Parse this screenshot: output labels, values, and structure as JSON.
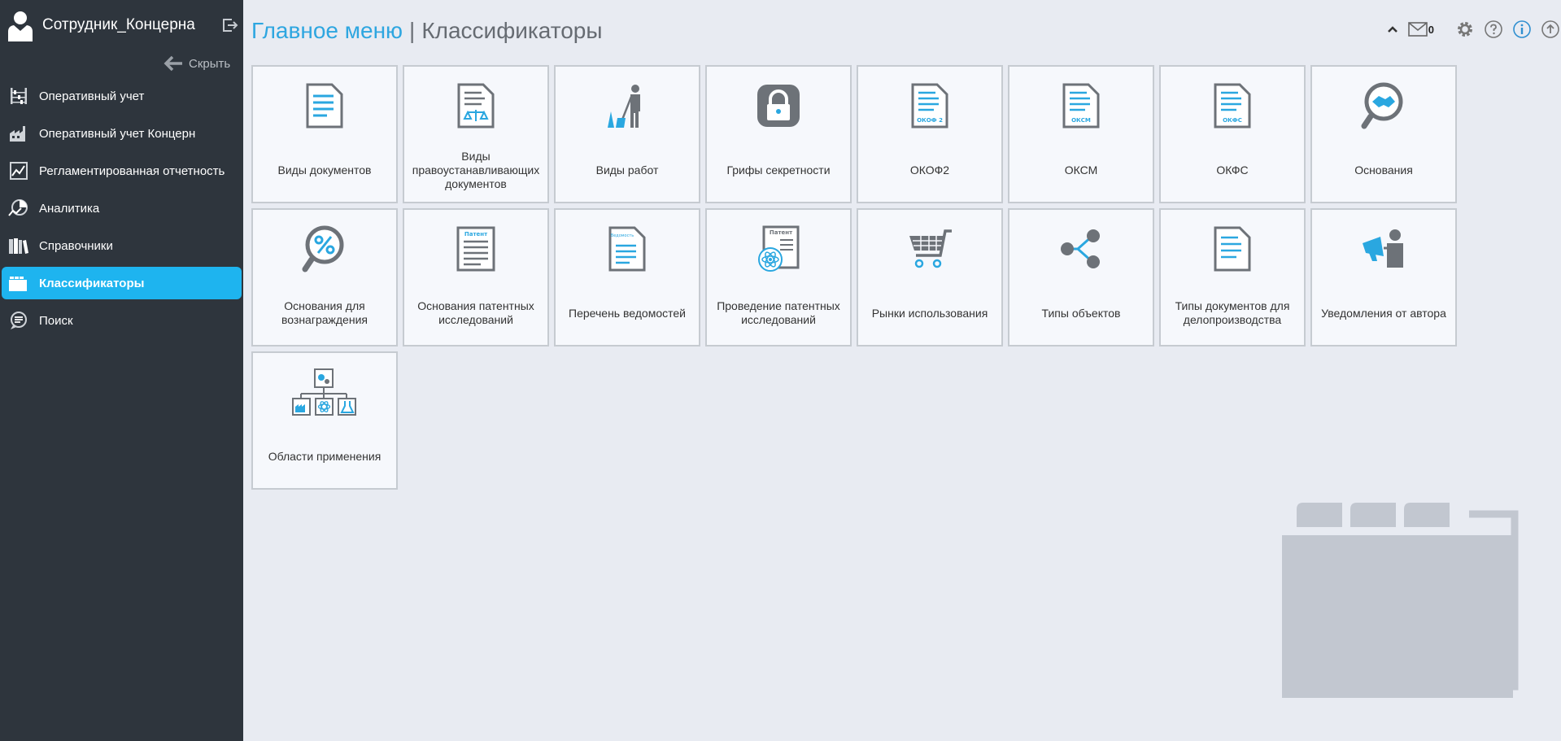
{
  "user": {
    "name": "Сотрудник_Концерна"
  },
  "sidebar": {
    "hide_label": "Скрыть",
    "items": [
      {
        "label": "Оперативный учет",
        "icon": "abacus-icon"
      },
      {
        "label": "Оперативный учет Концерн",
        "icon": "factory-icon"
      },
      {
        "label": "Регламентированная отчетность",
        "icon": "report-chart-icon"
      },
      {
        "label": "Аналитика",
        "icon": "analytics-icon"
      },
      {
        "label": "Справочники",
        "icon": "books-icon"
      },
      {
        "label": "Классификаторы",
        "icon": "folders-icon",
        "active": true
      },
      {
        "label": "Поиск",
        "icon": "search-chat-icon"
      }
    ]
  },
  "header": {
    "home": "Главное меню",
    "separator": "|",
    "current": "Классификаторы"
  },
  "toolbar": {
    "mail_count": "0"
  },
  "tiles": [
    {
      "label": "Виды документов",
      "icon": "document-icon"
    },
    {
      "label": "Виды правоустанавливающих документов",
      "icon": "document-scales-icon"
    },
    {
      "label": "Виды работ",
      "icon": "worker-shovel-icon"
    },
    {
      "label": "Грифы секретности",
      "icon": "lock-icon"
    },
    {
      "label": "ОКОФ2",
      "icon": "document-okof2-icon",
      "badge": "ОКОФ 2"
    },
    {
      "label": "ОКСМ",
      "icon": "document-oksm-icon",
      "badge": "ОКСМ"
    },
    {
      "label": "ОКФС",
      "icon": "document-okfs-icon",
      "badge": "ОКФС"
    },
    {
      "label": "Основания",
      "icon": "magnifier-handshake-icon"
    },
    {
      "label": "Основания для вознаграждения",
      "icon": "magnifier-percent-icon"
    },
    {
      "label": "Основания патентных исследований",
      "icon": "patent-document-icon",
      "badge": "Патент"
    },
    {
      "label": "Перечень ведомостей",
      "icon": "statement-document-icon",
      "badge": "Ведомость"
    },
    {
      "label": "Проведение патентных исследований",
      "icon": "patent-atom-icon",
      "badge": "Патент"
    },
    {
      "label": "Рынки использования",
      "icon": "shopping-cart-icon"
    },
    {
      "label": "Типы объектов",
      "icon": "share-nodes-icon"
    },
    {
      "label": "Типы документов для делопроизводства",
      "icon": "document-lines-icon"
    },
    {
      "label": "Уведомления от автора",
      "icon": "megaphone-person-icon"
    },
    {
      "label": "Области применения",
      "icon": "org-chart-icon"
    }
  ],
  "colors": {
    "accent": "#1eb4ef",
    "sidebar": "#2e353d",
    "icon_gray": "#6d7278",
    "icon_blue": "#2aa7e0"
  }
}
